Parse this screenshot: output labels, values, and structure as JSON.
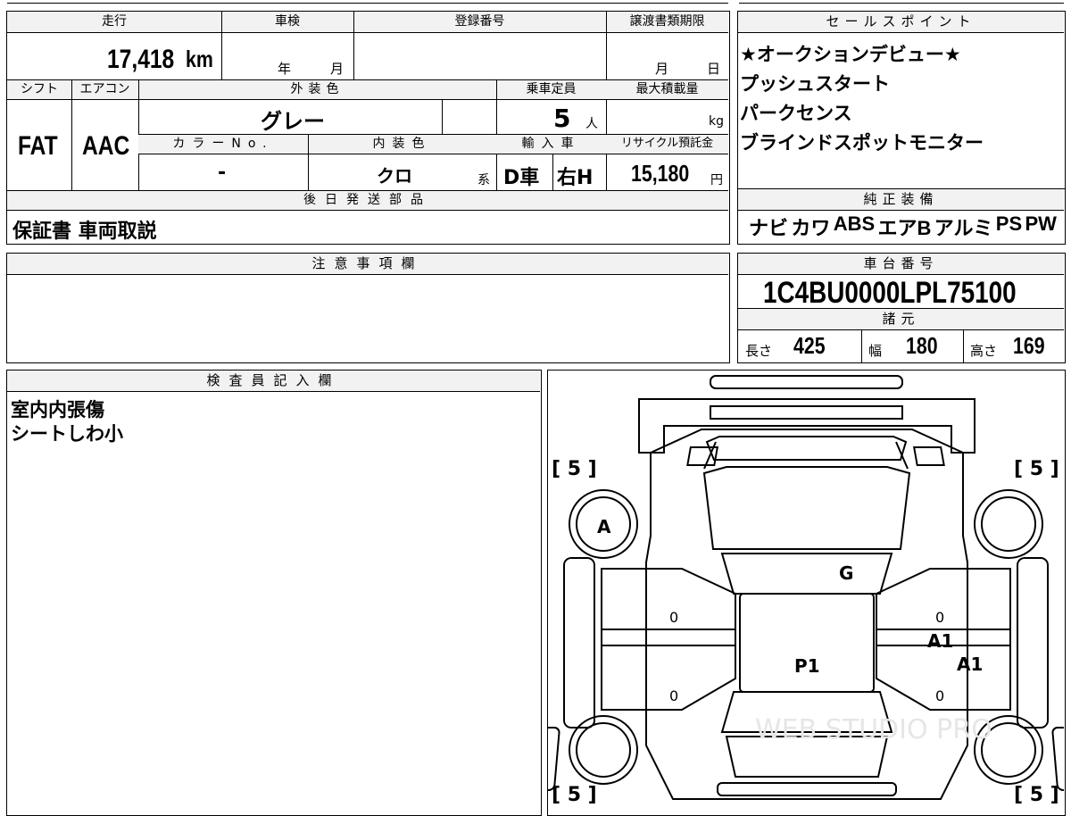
{
  "top": {
    "mileage_label": "走行",
    "mileage_value": "17,418",
    "mileage_unit": "km",
    "shaken_label": "車検",
    "shaken_year": "年",
    "shaken_month": "月",
    "reg_label": "登録番号",
    "transfer_label": "譲渡書類期限",
    "transfer_month": "月",
    "transfer_day": "日",
    "shift_label": "シフト",
    "shift_value": "FAT",
    "ac_label": "エアコン",
    "ac_value": "AAC",
    "ext_color_label": "外装色",
    "ext_color_value": "グレー",
    "capacity_label": "乗車定員",
    "capacity_value": "5",
    "capacity_unit": "人",
    "load_label": "最大積載量",
    "load_unit": "kg",
    "color_no_label": "カラーNo.",
    "color_no_value": "-",
    "int_color_label": "内装色",
    "int_color_value": "クロ",
    "int_color_suffix": "系",
    "import_label": "輸入車",
    "import_value": "D車",
    "handle_value": "右H",
    "recycle_label": "リサイクル預託金",
    "recycle_value": "15,180",
    "recycle_unit": "円",
    "later_parts_label": "後日発送部品",
    "later_parts_value": "保証書 車両取説"
  },
  "sales": {
    "label": "セールスポイント",
    "lines": [
      "★オークションデビュー★",
      "プッシュスタート",
      "パークセンス",
      "ブラインドスポットモニター"
    ]
  },
  "equipment": {
    "label": "純正装備",
    "items": [
      "ナビ",
      "カワ",
      "ABS",
      "エアB",
      "アルミ",
      "PS",
      "PW"
    ]
  },
  "notes": {
    "label": "注意事項欄",
    "value": ""
  },
  "chassis": {
    "label": "車台番号",
    "value": "1C4BU0000LPL75100"
  },
  "specs": {
    "label": "諸元",
    "length_label": "長さ",
    "length_value": "425",
    "width_label": "幅",
    "width_value": "180",
    "height_label": "高さ",
    "height_value": "169"
  },
  "inspector": {
    "label": "検査員記入欄",
    "lines": [
      "室内内張傷",
      "シートしわ小"
    ]
  },
  "diagram": {
    "tire_fl": "[ 5 ]",
    "tire_fr": "[ 5 ]",
    "tire_rl": "[ 5 ]",
    "tire_rr": "[ 5 ]",
    "mark_wheel": "A",
    "mark_windshield": "G",
    "mark_roof": "P1",
    "mark_rdoor1": "A1",
    "mark_rdoor2": "A1",
    "door_zero_1": "0",
    "door_zero_2": "0",
    "door_zero_3": "0",
    "door_zero_4": "0",
    "watermark": "WEB STUDIO PRO"
  }
}
